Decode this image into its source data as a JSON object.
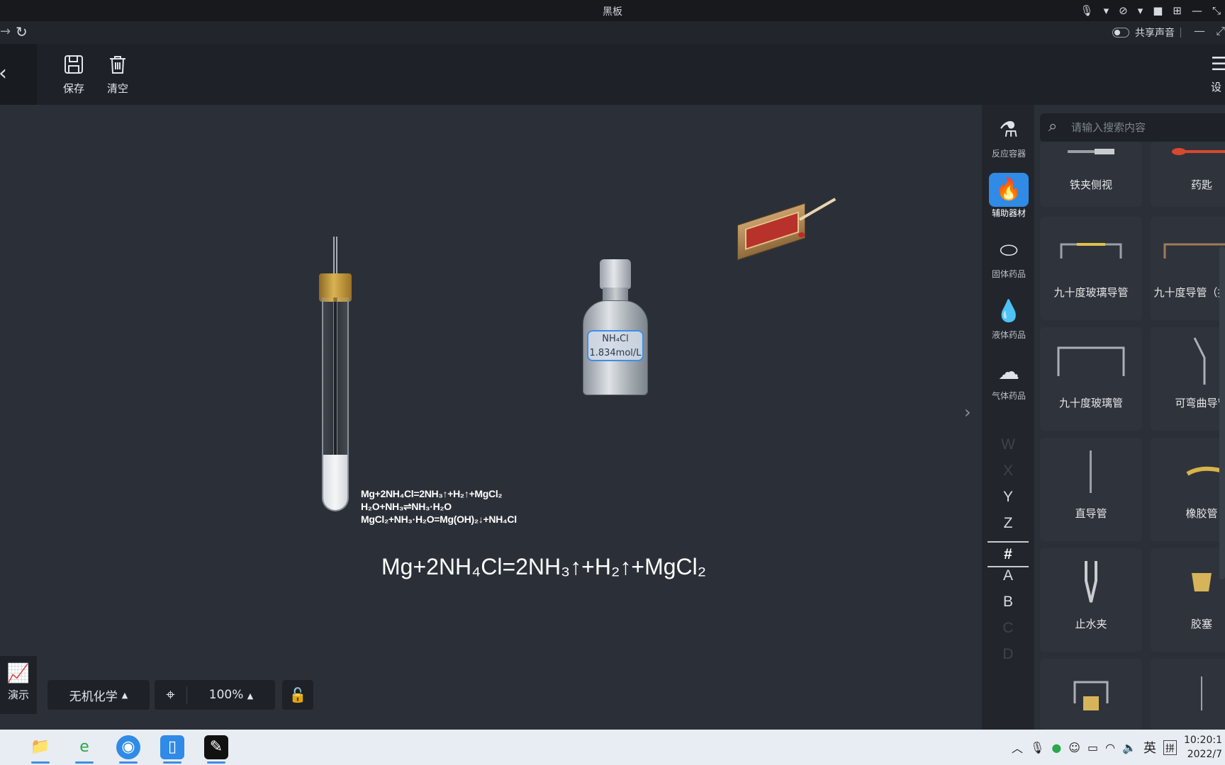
{
  "window": {
    "title": "黑板"
  },
  "titlebar_icons": [
    "mic-icon",
    "chevron-down-icon",
    "mic-off-icon",
    "chevron-down-icon",
    "camera-icon",
    "grid-icon",
    "minimize-icon",
    "restore-icon"
  ],
  "nav": {
    "share_label": "共享声音"
  },
  "toolbar": {
    "save_label": "保存",
    "clear_label": "清空",
    "settings_label": "设"
  },
  "canvas": {
    "bottle_label_line1": "NH₄Cl",
    "bottle_label_line2": "1.834mol/L",
    "equation_lines": [
      "Mg+2NH₄Cl=2NH₃↑+H₂↑+MgCl₂",
      "H₂O+NH₃⇌NH₃·H₂O",
      "MgCl₂+NH₃·H₂O=Mg(OH)₂↓+NH₄Cl"
    ],
    "main_equation": "Mg+2NH₄Cl=2NH₃↑+H₂↑+MgCl₂"
  },
  "bottom": {
    "present_label": "演示",
    "subject": "无机化学",
    "zoom": "100%"
  },
  "categories": [
    {
      "label": "反应容器",
      "icon": "flask-icon"
    },
    {
      "label": "辅助器材",
      "icon": "burner-icon",
      "active": true
    },
    {
      "label": "固体药品",
      "icon": "capsule-icon"
    },
    {
      "label": "液体药品",
      "icon": "drop-icon"
    },
    {
      "label": "气体药品",
      "icon": "cloud-icon"
    }
  ],
  "letters": [
    "W",
    "X",
    "Y",
    "Z",
    "#",
    "A",
    "B",
    "C",
    "D"
  ],
  "panel": {
    "search_placeholder": "请输入搜索内容",
    "items": [
      {
        "label": "铁夹侧视"
      },
      {
        "label": "药匙"
      },
      {
        "label": "九十度玻璃导管"
      },
      {
        "label": "九十度导管（拆分）"
      },
      {
        "label": "九十度玻璃管"
      },
      {
        "label": "可弯曲导管"
      },
      {
        "label": "直导管"
      },
      {
        "label": "橡胶管"
      },
      {
        "label": "止水夹"
      },
      {
        "label": "胶塞"
      }
    ]
  },
  "taskbar": {
    "apps": [
      "file-explorer-icon",
      "browser-icon",
      "chat-app-icon",
      "tablet-app-icon",
      "blackboard-app-icon"
    ],
    "ime_label": "英",
    "ime_mode": "拼",
    "time": "10:20:1",
    "date": "2022/7"
  }
}
